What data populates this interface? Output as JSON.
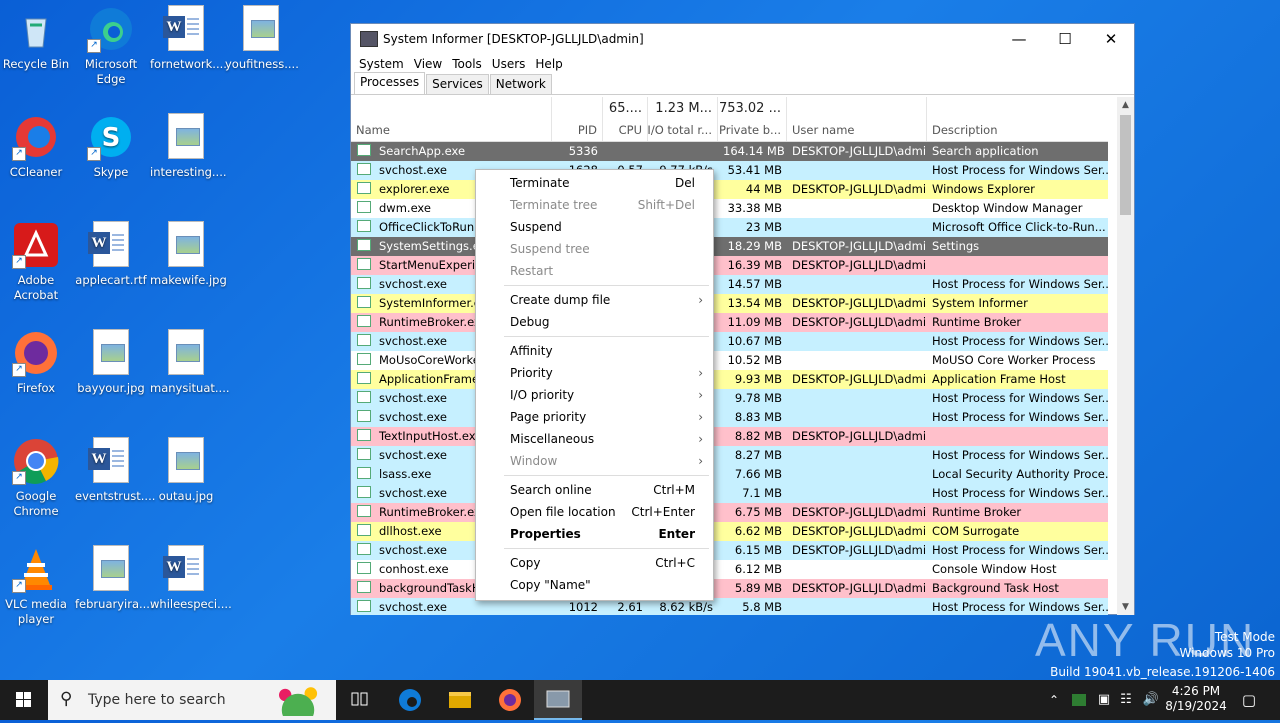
{
  "desktop_icons": [
    {
      "label": "Recycle Bin",
      "icon": "recycle-bin-icon"
    },
    {
      "label": "Microsoft Edge",
      "icon": "edge-icon"
    },
    {
      "label": "fornetwork....",
      "icon": "word-doc-icon"
    },
    {
      "label": "youfitness....",
      "icon": "image-file-icon"
    },
    {
      "label": "CCleaner",
      "icon": "ccleaner-icon"
    },
    {
      "label": "Skype",
      "icon": "skype-icon"
    },
    {
      "label": "interesting....",
      "icon": "image-file-icon"
    },
    {
      "label": "Adobe Acrobat",
      "icon": "acrobat-icon"
    },
    {
      "label": "applecart.rtf",
      "icon": "word-doc-icon"
    },
    {
      "label": "makewife.jpg",
      "icon": "image-file-icon"
    },
    {
      "label": "Firefox",
      "icon": "firefox-icon"
    },
    {
      "label": "bayyour.jpg",
      "icon": "image-file-icon"
    },
    {
      "label": "manysituat....",
      "icon": "image-file-icon"
    },
    {
      "label": "Google Chrome",
      "icon": "chrome-icon"
    },
    {
      "label": "eventstrust....",
      "icon": "word-doc-icon"
    },
    {
      "label": "outau.jpg",
      "icon": "image-file-icon"
    },
    {
      "label": "VLC media player",
      "icon": "vlc-icon"
    },
    {
      "label": "februaryira....",
      "icon": "image-file-icon"
    },
    {
      "label": "whileespeci....",
      "icon": "word-doc-icon"
    }
  ],
  "window": {
    "title": "System Informer [DESKTOP-JGLLJLD\\admin]",
    "menu": [
      "System",
      "View",
      "Tools",
      "Users",
      "Help"
    ],
    "tabs": [
      "Processes",
      "Services",
      "Network"
    ],
    "active_tab": "Processes",
    "header_totals": {
      "cpu": "65....",
      "io": "1.23 M...",
      "private": "753.02 ..."
    },
    "columns": {
      "name": "Name",
      "pid": "PID",
      "cpu": "CPU",
      "io": "I/O total r...",
      "private": "Private b...",
      "user": "User name",
      "desc": "Description"
    },
    "rows": [
      {
        "name": "SearchApp.exe",
        "pid": "5336",
        "cpu": "",
        "io": "",
        "priv": "164.14 MB",
        "user": "DESKTOP-JGLLJLD\\admi",
        "desc": "Search application",
        "color": "#6e6e6e"
      },
      {
        "name": "svchost.exe",
        "pid": "1628",
        "cpu": "0.57",
        "io": "9.77 kB/s",
        "priv": "53.41 MB",
        "user": "",
        "desc": "Host Process for Windows Ser...",
        "color": "#c6f0ff"
      },
      {
        "name": "explorer.exe",
        "pid": "",
        "cpu": "",
        "io": "",
        "priv": "44 MB",
        "user": "DESKTOP-JGLLJLD\\admi",
        "desc": "Windows Explorer",
        "color": "#ffff9e"
      },
      {
        "name": "dwm.exe",
        "pid": "",
        "cpu": "",
        "io": "",
        "priv": "33.38 MB",
        "user": "",
        "desc": "Desktop Window Manager",
        "color": "#ffffff"
      },
      {
        "name": "OfficeClickToRun.e",
        "pid": "",
        "cpu": "",
        "io": "",
        "priv": "23 MB",
        "user": "",
        "desc": "Microsoft Office Click-to-Run...",
        "color": "#c6f0ff"
      },
      {
        "name": "SystemSettings.exe",
        "pid": "",
        "cpu": "",
        "io": "",
        "priv": "18.29 MB",
        "user": "DESKTOP-JGLLJLD\\admi",
        "desc": "Settings",
        "color": "#6e6e6e"
      },
      {
        "name": "StartMenuExperien",
        "pid": "",
        "cpu": "",
        "io": "",
        "priv": "16.39 MB",
        "user": "DESKTOP-JGLLJLD\\admi",
        "desc": "",
        "color": "#ffc0cb"
      },
      {
        "name": "svchost.exe",
        "pid": "",
        "cpu": "",
        "io": "",
        "priv": "14.57 MB",
        "user": "",
        "desc": "Host Process for Windows Ser...",
        "color": "#c6f0ff"
      },
      {
        "name": "SystemInformer.exe",
        "pid": "",
        "cpu": "",
        "io": "",
        "priv": "13.54 MB",
        "user": "DESKTOP-JGLLJLD\\admi",
        "desc": "System Informer",
        "color": "#ffff9e"
      },
      {
        "name": "RuntimeBroker.exe",
        "pid": "",
        "cpu": "",
        "io": "",
        "priv": "11.09 MB",
        "user": "DESKTOP-JGLLJLD\\admi",
        "desc": "Runtime Broker",
        "color": "#ffc0cb"
      },
      {
        "name": "svchost.exe",
        "pid": "",
        "cpu": "",
        "io": "",
        "priv": "10.67 MB",
        "user": "",
        "desc": "Host Process for Windows Ser...",
        "color": "#c6f0ff"
      },
      {
        "name": "MoUsoCoreWorke",
        "pid": "",
        "cpu": "",
        "io": "",
        "priv": "10.52 MB",
        "user": "",
        "desc": "MoUSO Core Worker Process",
        "color": "#ffffff"
      },
      {
        "name": "ApplicationFrameH",
        "pid": "",
        "cpu": "",
        "io": "",
        "priv": "9.93 MB",
        "user": "DESKTOP-JGLLJLD\\admi",
        "desc": "Application Frame Host",
        "color": "#ffff9e"
      },
      {
        "name": "svchost.exe",
        "pid": "",
        "cpu": "",
        "io": "",
        "priv": "9.78 MB",
        "user": "",
        "desc": "Host Process for Windows Ser...",
        "color": "#c6f0ff"
      },
      {
        "name": "svchost.exe",
        "pid": "",
        "cpu": "",
        "io": "",
        "priv": "8.83 MB",
        "user": "",
        "desc": "Host Process for Windows Ser...",
        "color": "#c6f0ff"
      },
      {
        "name": "TextInputHost.exe",
        "pid": "",
        "cpu": "",
        "io": "",
        "priv": "8.82 MB",
        "user": "DESKTOP-JGLLJLD\\admi",
        "desc": "",
        "color": "#ffc0cb"
      },
      {
        "name": "svchost.exe",
        "pid": "",
        "cpu": "",
        "io": "",
        "priv": "8.27 MB",
        "user": "",
        "desc": "Host Process for Windows Ser...",
        "color": "#c6f0ff"
      },
      {
        "name": "lsass.exe",
        "pid": "",
        "cpu": "",
        "io": "",
        "priv": "7.66 MB",
        "user": "",
        "desc": "Local Security Authority Proce...",
        "color": "#c6f0ff"
      },
      {
        "name": "svchost.exe",
        "pid": "",
        "cpu": "",
        "io": "",
        "priv": "7.1 MB",
        "user": "",
        "desc": "Host Process for Windows Ser...",
        "color": "#c6f0ff"
      },
      {
        "name": "RuntimeBroker.exe",
        "pid": "",
        "cpu": "",
        "io": "",
        "priv": "6.75 MB",
        "user": "DESKTOP-JGLLJLD\\admi",
        "desc": "Runtime Broker",
        "color": "#ffc0cb"
      },
      {
        "name": "dllhost.exe",
        "pid": "",
        "cpu": "",
        "io": "",
        "priv": "6.62 MB",
        "user": "DESKTOP-JGLLJLD\\admi",
        "desc": "COM Surrogate",
        "color": "#ffff9e"
      },
      {
        "name": "svchost.exe",
        "pid": "",
        "cpu": "",
        "io": "",
        "priv": "6.15 MB",
        "user": "DESKTOP-JGLLJLD\\admi",
        "desc": "Host Process for Windows Ser...",
        "color": "#c6f0ff"
      },
      {
        "name": "conhost.exe",
        "pid": "",
        "cpu": "",
        "io": "",
        "priv": "6.12 MB",
        "user": "",
        "desc": "Console Window Host",
        "color": "#ffffff"
      },
      {
        "name": "backgroundTaskHo",
        "pid": "",
        "cpu": "",
        "io": "",
        "priv": "5.89 MB",
        "user": "DESKTOP-JGLLJLD\\admi",
        "desc": "Background Task Host",
        "color": "#ffc0cb"
      },
      {
        "name": "svchost.exe",
        "pid": "1012",
        "cpu": "2.61",
        "io": "8.62 kB/s",
        "priv": "5.8 MB",
        "user": "",
        "desc": "Host Process for Windows Ser...",
        "color": "#c6f0ff"
      }
    ]
  },
  "context_menu": [
    {
      "label": "Terminate",
      "shortcut": "Del",
      "state": "normal"
    },
    {
      "label": "Terminate tree",
      "shortcut": "Shift+Del",
      "state": "disabled"
    },
    {
      "label": "Suspend",
      "shortcut": "",
      "state": "normal"
    },
    {
      "label": "Suspend tree",
      "shortcut": "",
      "state": "disabled"
    },
    {
      "label": "Restart",
      "shortcut": "",
      "state": "disabled"
    },
    {
      "sep": true
    },
    {
      "label": "Create dump file",
      "shortcut": "",
      "state": "normal",
      "submenu": true
    },
    {
      "label": "Debug",
      "shortcut": "",
      "state": "normal"
    },
    {
      "sep": true
    },
    {
      "label": "Affinity",
      "shortcut": "",
      "state": "normal"
    },
    {
      "label": "Priority",
      "shortcut": "",
      "state": "normal",
      "submenu": true
    },
    {
      "label": "I/O priority",
      "shortcut": "",
      "state": "normal",
      "submenu": true
    },
    {
      "label": "Page priority",
      "shortcut": "",
      "state": "normal",
      "submenu": true
    },
    {
      "label": "Miscellaneous",
      "shortcut": "",
      "state": "normal",
      "submenu": true
    },
    {
      "label": "Window",
      "shortcut": "",
      "state": "disabled",
      "submenu": true
    },
    {
      "sep": true
    },
    {
      "label": "Search online",
      "shortcut": "Ctrl+M",
      "state": "normal"
    },
    {
      "label": "Open file location",
      "shortcut": "Ctrl+Enter",
      "state": "normal"
    },
    {
      "label": "Properties",
      "shortcut": "Enter",
      "state": "bold"
    },
    {
      "sep": true
    },
    {
      "label": "Copy",
      "shortcut": "Ctrl+C",
      "state": "normal"
    },
    {
      "label": "Copy \"Name\"",
      "shortcut": "",
      "state": "normal"
    }
  ],
  "taskbar": {
    "search_placeholder": "Type here to search",
    "time": "4:26 PM",
    "date": "8/19/2024"
  },
  "watermark": {
    "brand": "ANY RUN",
    "line1": "Test Mode",
    "line2": "Windows 10 Pro",
    "line3": "Build 19041.vb_release.191206-1406"
  }
}
